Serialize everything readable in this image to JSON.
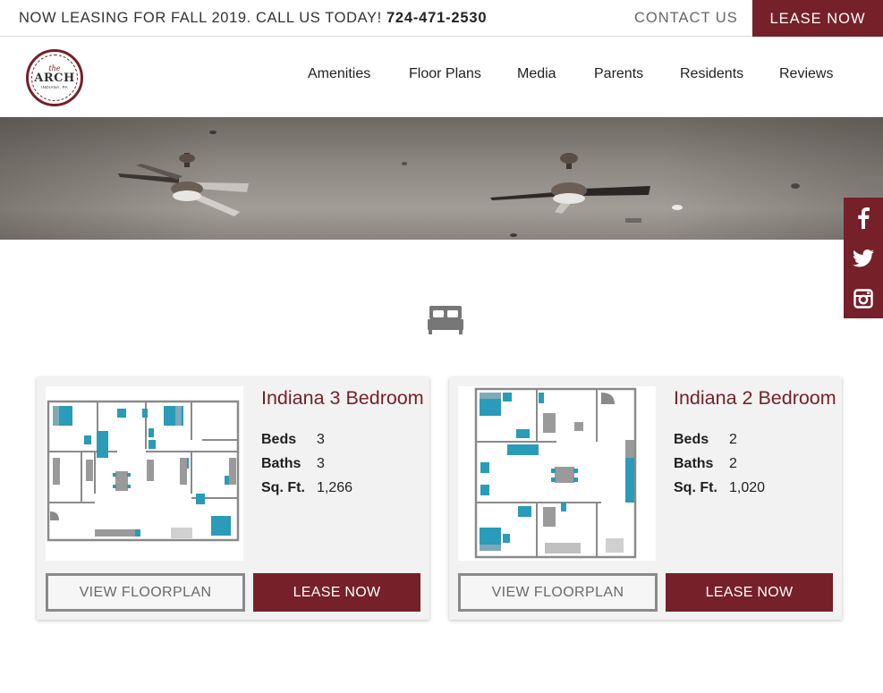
{
  "topbar": {
    "promo_text": "NOW LEASING FOR FALL 2019. CALL US TODAY!",
    "phone": "724-471-2530",
    "contact_label": "CONTACT US",
    "lease_label": "LEASE NOW"
  },
  "logo": {
    "the": "the",
    "name": "ARCH",
    "location": "INDIANA, PA"
  },
  "nav": {
    "items": [
      "Amenities",
      "Floor Plans",
      "Media",
      "Parents",
      "Residents",
      "Reviews"
    ]
  },
  "social": {
    "icons": [
      "facebook-icon",
      "twitter-icon",
      "instagram-icon"
    ]
  },
  "colors": {
    "accent": "#762029",
    "floorplan_furniture": "#2a9bb8"
  },
  "cards": [
    {
      "title": "Indiana 3 Bedroom",
      "beds_label": "Beds",
      "beds": "3",
      "baths_label": "Baths",
      "baths": "3",
      "sqft_label": "Sq. Ft.",
      "sqft": "1,266",
      "view_label": "VIEW FLOORPLAN",
      "lease_label": "LEASE NOW"
    },
    {
      "title": "Indiana 2 Bedroom",
      "beds_label": "Beds",
      "beds": "2",
      "baths_label": "Baths",
      "baths": "2",
      "sqft_label": "Sq. Ft.",
      "sqft": "1,020",
      "view_label": "VIEW FLOORPLAN",
      "lease_label": "LEASE NOW"
    }
  ]
}
